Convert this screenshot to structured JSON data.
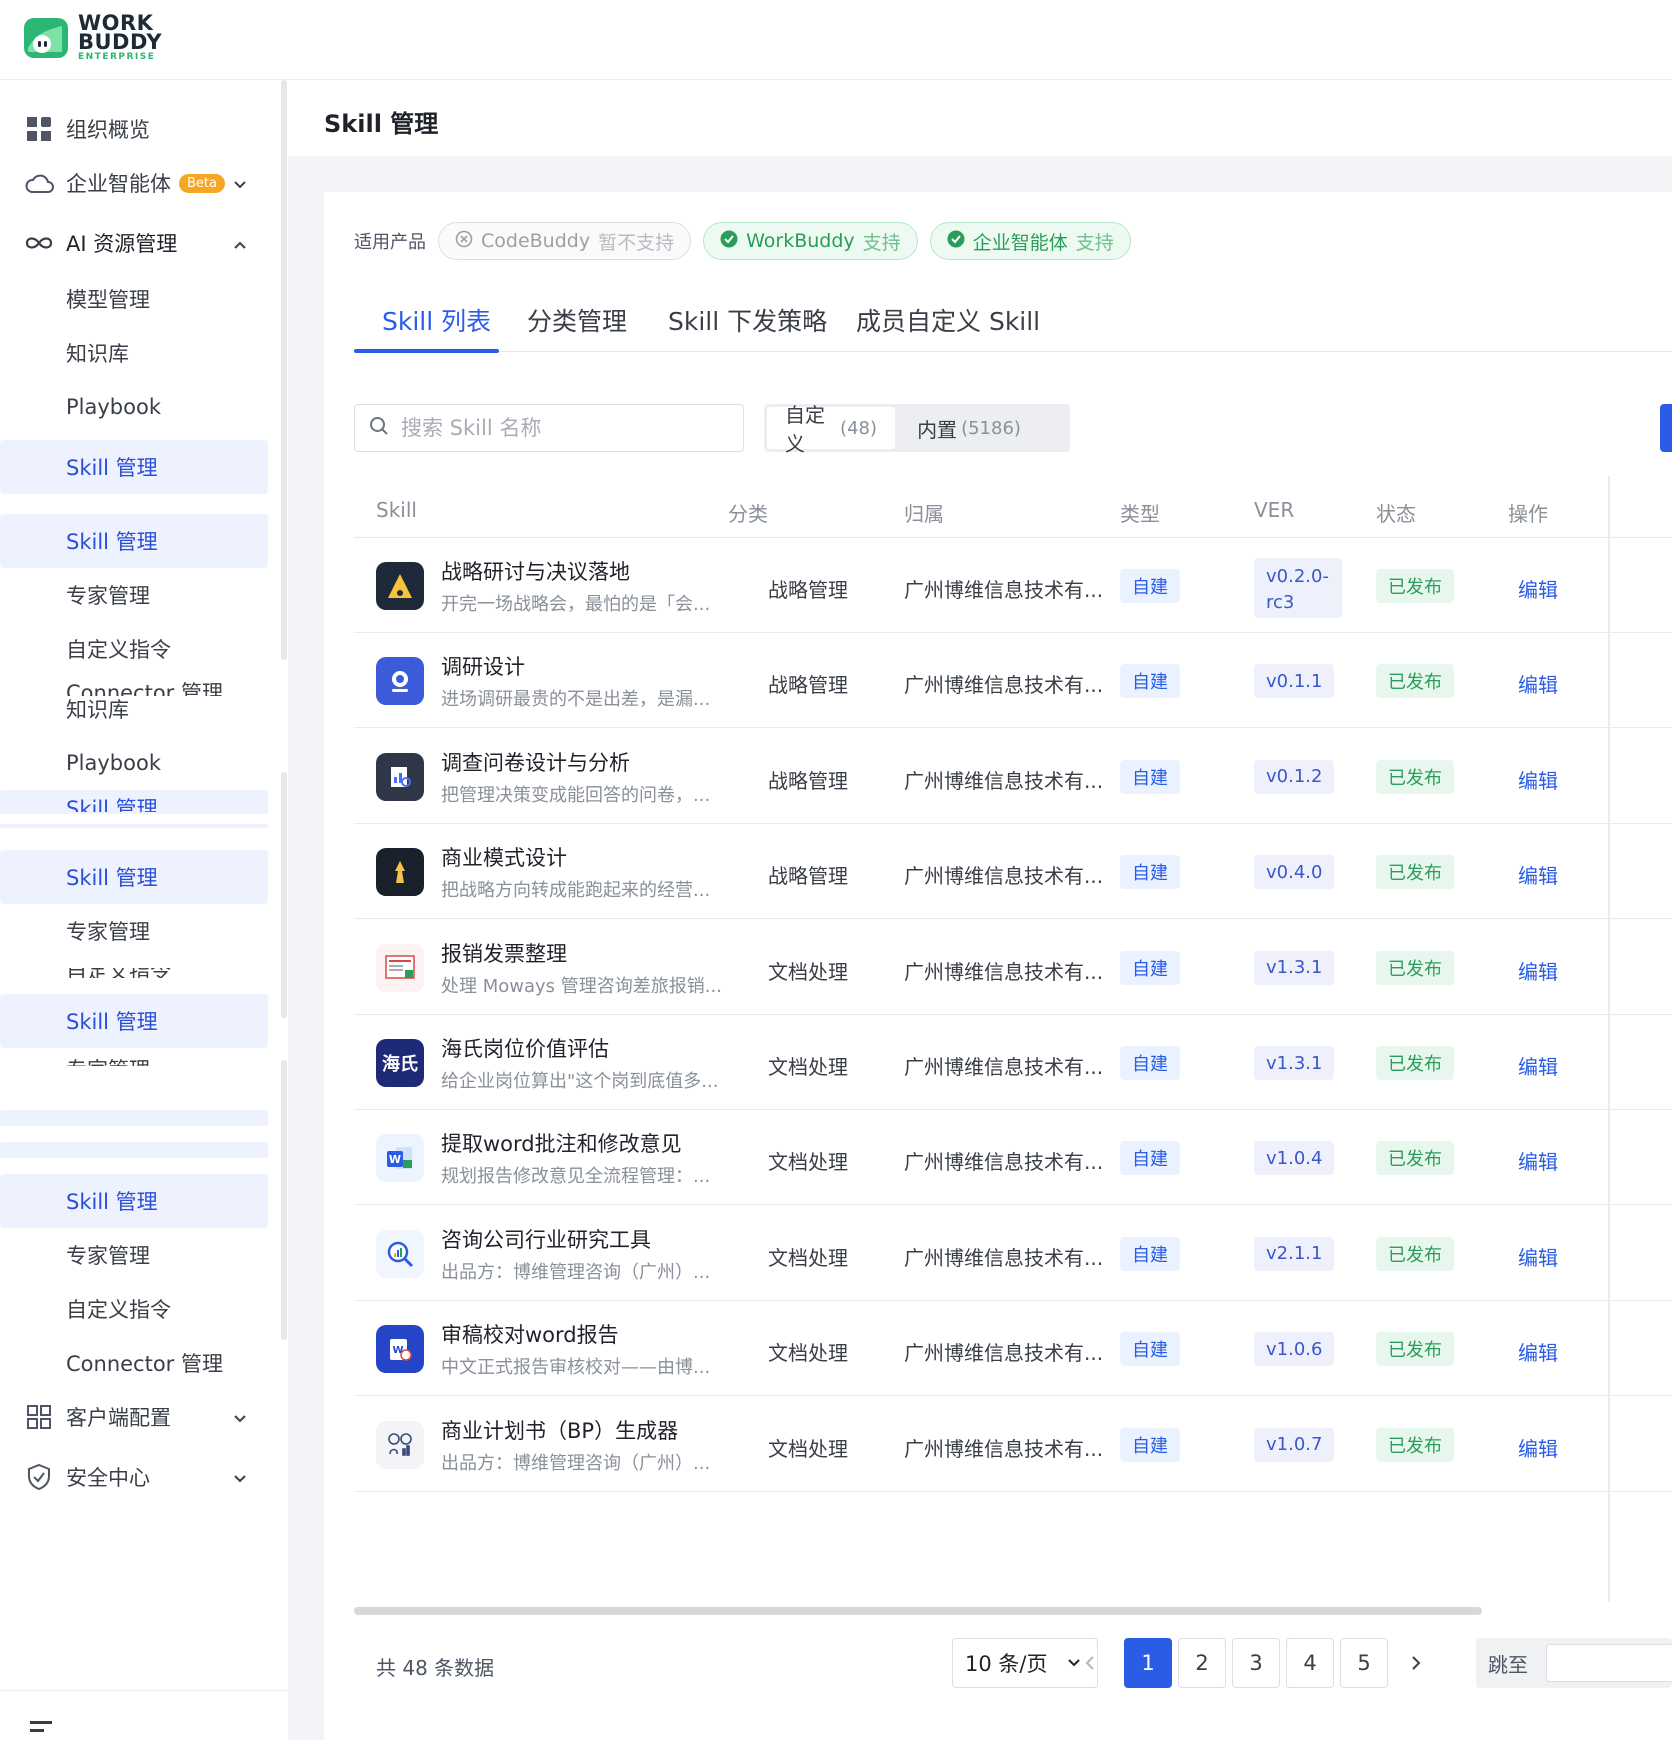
{
  "logo": {
    "line1": "WORK",
    "line2": "BUDDY",
    "sub": "ENTERPRISE"
  },
  "sidebar": {
    "org_overview": "组织概览",
    "enterprise_agent": "企业智能体",
    "beta": "Beta",
    "ai_resources": "AI 资源管理",
    "items": [
      "模型管理",
      "知识库",
      "Playbook",
      "Skill 管理",
      "Skill 管理",
      "专家管理",
      "自定义指令",
      "Connector 管理",
      "知识库",
      "Playbook",
      "Skill 管理",
      "Skill 管理",
      "专家管理",
      "自定义指令",
      "Skill 管理",
      "专家管理",
      "Skill 管理",
      "专家管理",
      "自定义指令",
      "Connector 管理"
    ],
    "client_config": "客户端配置",
    "security": "安全中心"
  },
  "page": {
    "title": "Skill 管理"
  },
  "products": {
    "label": "适用产品",
    "chips": [
      {
        "name": "CodeBuddy",
        "status": "暂不支持"
      },
      {
        "name": "WorkBuddy",
        "status": "支持"
      },
      {
        "name": "企业智能体",
        "status": "支持"
      }
    ]
  },
  "tabs": [
    "Skill 列表",
    "分类管理",
    "Skill 下发策略",
    "成员自定义 Skill"
  ],
  "search": {
    "placeholder": "搜索 Skill 名称"
  },
  "segment": {
    "custom": "自定义",
    "custom_count": "(48)",
    "builtin": "内置",
    "builtin_count": "(5186)"
  },
  "table": {
    "headers": [
      "Skill",
      "分类",
      "归属",
      "类型",
      "VER",
      "状态",
      "操作"
    ],
    "rows": [
      {
        "name": "战略研讨与决议落地",
        "desc": "开完一场战略会，最怕的是「会...",
        "category": "战略管理",
        "owner": "广州博维信息技术有...",
        "type": "自建",
        "ver": "v0.2.0-rc3",
        "status": "已发布",
        "op": "编辑"
      },
      {
        "name": "调研设计",
        "desc": "进场调研最贵的不是出差，是漏...",
        "category": "战略管理",
        "owner": "广州博维信息技术有...",
        "type": "自建",
        "ver": "v0.1.1",
        "status": "已发布",
        "op": "编辑"
      },
      {
        "name": "调查问卷设计与分析",
        "desc": "把管理决策变成能回答的问卷，...",
        "category": "战略管理",
        "owner": "广州博维信息技术有...",
        "type": "自建",
        "ver": "v0.1.2",
        "status": "已发布",
        "op": "编辑"
      },
      {
        "name": "商业模式设计",
        "desc": "把战略方向转成能跑起来的经营...",
        "category": "战略管理",
        "owner": "广州博维信息技术有...",
        "type": "自建",
        "ver": "v0.4.0",
        "status": "已发布",
        "op": "编辑"
      },
      {
        "name": "报销发票整理",
        "desc": "处理 Moways 管理咨询差旅报销...",
        "category": "文档处理",
        "owner": "广州博维信息技术有...",
        "type": "自建",
        "ver": "v1.3.1",
        "status": "已发布",
        "op": "编辑"
      },
      {
        "name": "海氏岗位价值评估",
        "desc": "给企业岗位算出\"这个岗到底值多...",
        "category": "文档处理",
        "owner": "广州博维信息技术有...",
        "type": "自建",
        "ver": "v1.3.1",
        "status": "已发布",
        "op": "编辑"
      },
      {
        "name": "提取word批注和修改意见",
        "desc": "规划报告修改意见全流程管理：...",
        "category": "文档处理",
        "owner": "广州博维信息技术有...",
        "type": "自建",
        "ver": "v1.0.4",
        "status": "已发布",
        "op": "编辑"
      },
      {
        "name": "咨询公司行业研究工具",
        "desc": "出品方：博维管理咨询（广州）...",
        "category": "文档处理",
        "owner": "广州博维信息技术有...",
        "type": "自建",
        "ver": "v2.1.1",
        "status": "已发布",
        "op": "编辑"
      },
      {
        "name": "审稿校对word报告",
        "desc": "中文正式报告审核校对——由博...",
        "category": "文档处理",
        "owner": "广州博维信息技术有...",
        "type": "自建",
        "ver": "v1.0.6",
        "status": "已发布",
        "op": "编辑"
      },
      {
        "name": "商业计划书（BP）生成器",
        "desc": "出品方：博维管理咨询（广州）...",
        "category": "文档处理",
        "owner": "广州博维信息技术有...",
        "type": "自建",
        "ver": "v1.0.7",
        "status": "已发布",
        "op": "编辑"
      }
    ]
  },
  "pagination": {
    "total": "共 48 条数据",
    "page_size": "10 条/页",
    "pages": [
      "1",
      "2",
      "3",
      "4",
      "5"
    ],
    "current": "1",
    "jump_label": "跳至"
  },
  "icons": {
    "row5": "海氏"
  },
  "colors": {
    "accent": "#2b5ce6",
    "success": "#2a9d5a",
    "beta": "#f5a623"
  }
}
